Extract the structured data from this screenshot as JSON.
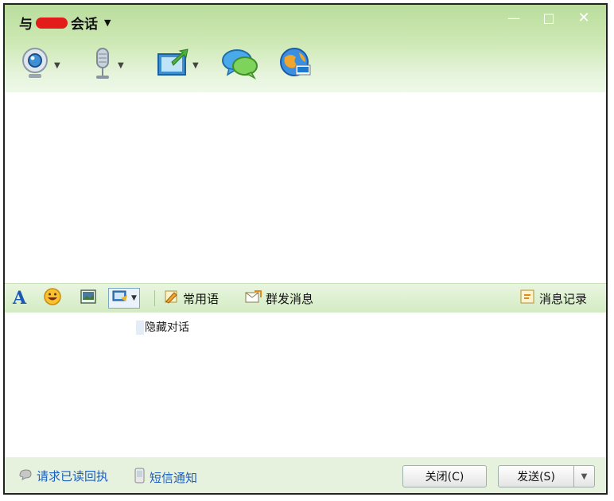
{
  "window": {
    "title_prefix": "与",
    "title_suffix": "会话",
    "controls": {
      "minimize": "—",
      "maximize": "□",
      "close": "✕"
    }
  },
  "toolbar": {
    "items": [
      {
        "icon": "webcam-icon",
        "has_dropdown": true
      },
      {
        "icon": "microphone-icon",
        "has_dropdown": true
      },
      {
        "icon": "file-transfer-icon",
        "has_dropdown": true
      },
      {
        "icon": "chat-bubbles-icon",
        "has_dropdown": false
      },
      {
        "icon": "globe-app-icon",
        "has_dropdown": false
      }
    ]
  },
  "midbar": {
    "common_phrases": "常用语",
    "group_message": "群发消息",
    "message_history": "消息记录"
  },
  "input": {
    "hidden_chat": "隐藏对话"
  },
  "bottom": {
    "read_receipt": "请求已读回执",
    "sms_notice": "短信通知",
    "close_button": "关闭(C)",
    "send_button": "发送(S)"
  },
  "colors": {
    "title_green": "#b9dd9c",
    "bar_green": "#d3ecc3",
    "link_blue": "#1c5fc0"
  }
}
